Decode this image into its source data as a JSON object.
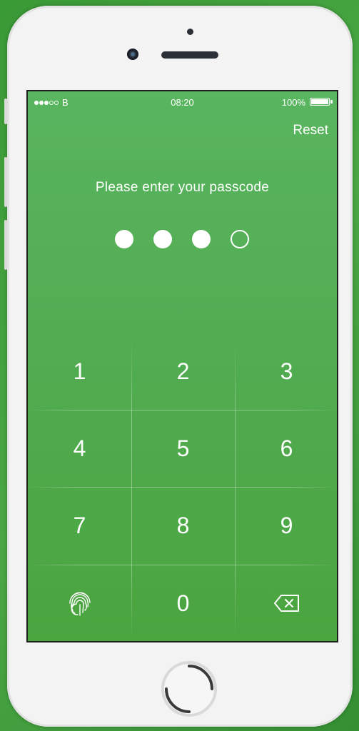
{
  "status_bar": {
    "carrier": "B",
    "time": "08:20",
    "battery": "100%",
    "signal_full": 3,
    "signal_empty": 2,
    "battery_level": 1.0
  },
  "header": {
    "reset_label": "Reset"
  },
  "prompt": {
    "text": "Please enter your passcode"
  },
  "passcode": {
    "length": 4,
    "entered": 3
  },
  "keypad": {
    "keys": [
      "1",
      "2",
      "3",
      "4",
      "5",
      "6",
      "7",
      "8",
      "9",
      "0"
    ],
    "fingerprint_icon": "fingerprint-icon",
    "delete_icon": "backspace-icon"
  },
  "colors": {
    "screen_top": "#59b55f",
    "screen_bottom": "#4aa53f",
    "text": "#ffffff"
  }
}
